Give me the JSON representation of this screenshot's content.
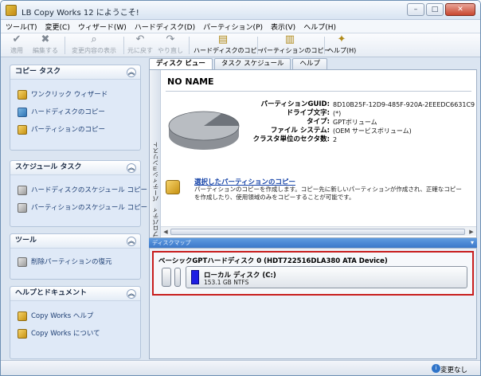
{
  "window": {
    "title": "LB Copy Works 12 にようこそ!",
    "buttons": {
      "minimize": "–",
      "maximize": "□",
      "close": "✕"
    }
  },
  "menu": [
    "ツール(T)",
    "変更(C)",
    "ウィザード(W)",
    "ハードディスク(D)",
    "パーティション(P)",
    "表示(V)",
    "ヘルプ(H)"
  ],
  "toolbar": {
    "apply": "適用",
    "edit": "編集する",
    "show_changes": "変更内容の表示",
    "undo": "元に戻す",
    "redo": "やり直し",
    "copy_disk": "ハードディスクのコピー",
    "copy_partition": "パーティションのコピー",
    "help": "ヘルプ(H)"
  },
  "sidebar": {
    "copy_task": {
      "title": "コピー タスク",
      "items": [
        "ワンクリック ウィザード",
        "ハードディスクのコピー",
        "パーティションのコピー"
      ]
    },
    "schedule_task": {
      "title": "スケジュール タスク",
      "items": [
        "ハードディスクのスケジュール コピー",
        "パーティションのスケジュール コピー"
      ]
    },
    "tools": {
      "title": "ツール",
      "items": [
        "削除パーティションの復元"
      ]
    },
    "help_docs": {
      "title": "ヘルプとドキュメント",
      "items": [
        "Copy Works ヘルプ",
        "Copy Works について"
      ]
    }
  },
  "tabs": [
    "ディスク ビュー",
    "タスク スケジュール",
    "ヘルプ"
  ],
  "side_strip": {
    "top": "パーティションリスト",
    "bottom": "プロパティ"
  },
  "partition": {
    "name": "NO NAME",
    "info": [
      {
        "key": "パーティションGUID:",
        "value": "8D10B25F-12D9-485F-920A-2EEEDC6631C9"
      },
      {
        "key": "ドライブ文字:",
        "value": "(*)"
      },
      {
        "key": "タイプ:",
        "value": "GPTボリューム"
      },
      {
        "key": "ファイル システム:",
        "value": "(OEM サービスボリューム)"
      },
      {
        "key": "クラスタ単位のセクタ数:",
        "value": "2"
      }
    ],
    "copy_link": "選択したパーティションのコピー",
    "copy_desc": "パーティションのコピーを作成します。コピー先に新しいパーティションが作成され、正確なコピーを作成したり、使用領域のみをコピーすることが可能です。"
  },
  "diskmap": {
    "header": "ディスクマップ",
    "disk_title": "ベーシックGPTハードディスク 0 (HDT722516DLA380 ATA Device)",
    "partition_label": "ローカル ディスク (C:)",
    "partition_size": "153.1 GB NTFS",
    "partition_color": "#1e1ee3"
  },
  "status": {
    "text": "変更なし"
  },
  "colors": {
    "accent": "#3b78c9",
    "highlight_border": "#c81e1e",
    "link": "#1543a8"
  }
}
